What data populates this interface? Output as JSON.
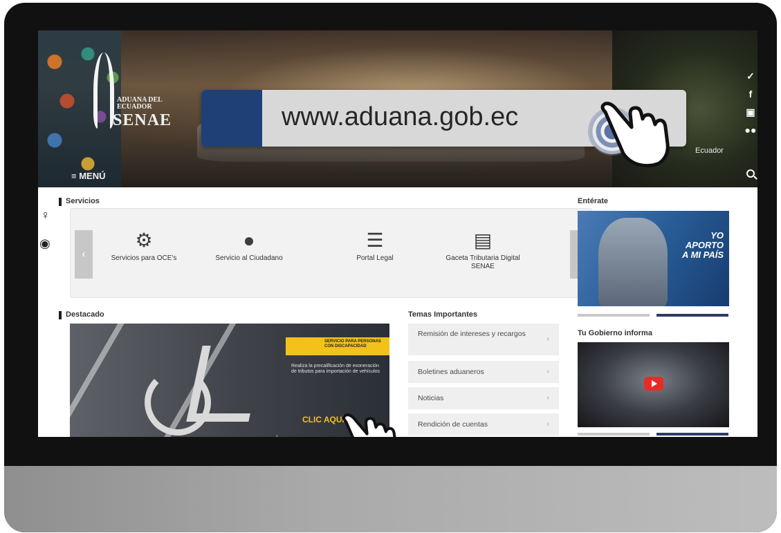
{
  "address_bar": {
    "url": "www.aduana.gob.ec"
  },
  "header": {
    "logo_line1": "ADUANA DEL",
    "logo_line2": "ECUADOR",
    "logo_big": "SENAE",
    "menu_label": "≡ MENÚ",
    "location": "Ecuador",
    "social": [
      "twitter-icon",
      "facebook-icon",
      "youtube-icon",
      "flickr-icon"
    ]
  },
  "servicios": {
    "title": "Servicios",
    "items": [
      {
        "label": "Servicios para OCE's",
        "icon": "gear-icon"
      },
      {
        "label": "Servicio al Ciudadano",
        "icon": "person-icon"
      },
      {
        "label": "Portal Legal",
        "icon": "document-icon"
      },
      {
        "label": "Gaceta Tributaria Digital SENAE",
        "icon": "file-icon"
      }
    ]
  },
  "destacado": {
    "title": "Destacado",
    "tag": "SERVICIO PARA PERSONAS CON DISCAPACIDAD",
    "body": "Realiza la precalificación de exoneración de tributos para importación de vehículos",
    "cta": "CLIC AQUÍ"
  },
  "temas": {
    "title": "Temas Importantes",
    "items": [
      "Remisión de intereses y recargos",
      "Boletines aduaneros",
      "Noticias",
      "Rendición de cuentas"
    ]
  },
  "right": {
    "enterate_title": "Entérate",
    "enterate_lines": [
      "YO",
      "APORTO",
      "A MI PAÍS"
    ],
    "gobierno_title": "Tu Gobierno informa"
  },
  "colors": {
    "accent": "#1f3f77",
    "highlight": "#f2c21b",
    "play": "#e52d27"
  }
}
